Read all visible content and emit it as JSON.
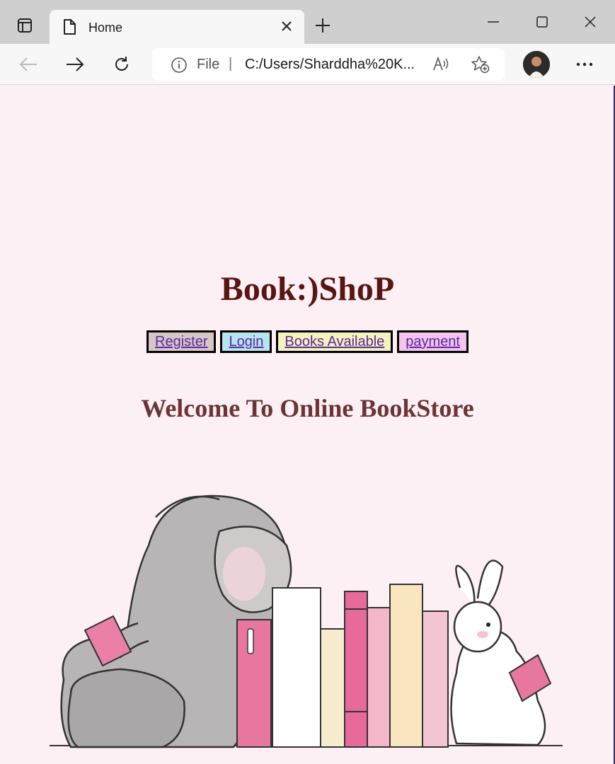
{
  "browser": {
    "tab_title": "Home",
    "address": {
      "scheme_label": "File",
      "separator": "|",
      "url": "C:/Users/Sharddha%20K..."
    }
  },
  "page": {
    "heading": "Book:)ShoP",
    "nav": [
      {
        "label": "Register",
        "bg": "#d6c6c6"
      },
      {
        "label": "Login",
        "bg": "#b6e4ef"
      },
      {
        "label": "Books Available",
        "bg": "#f4f2bd"
      },
      {
        "label": "payment",
        "bg": "#f4c3ef"
      }
    ],
    "welcome": "Welcome To Online BookStore"
  },
  "colors": {
    "page_bg": "#fdf0f4",
    "heading": "#5a1414",
    "welcome": "#6b3438",
    "link": "#5b2aa0"
  }
}
